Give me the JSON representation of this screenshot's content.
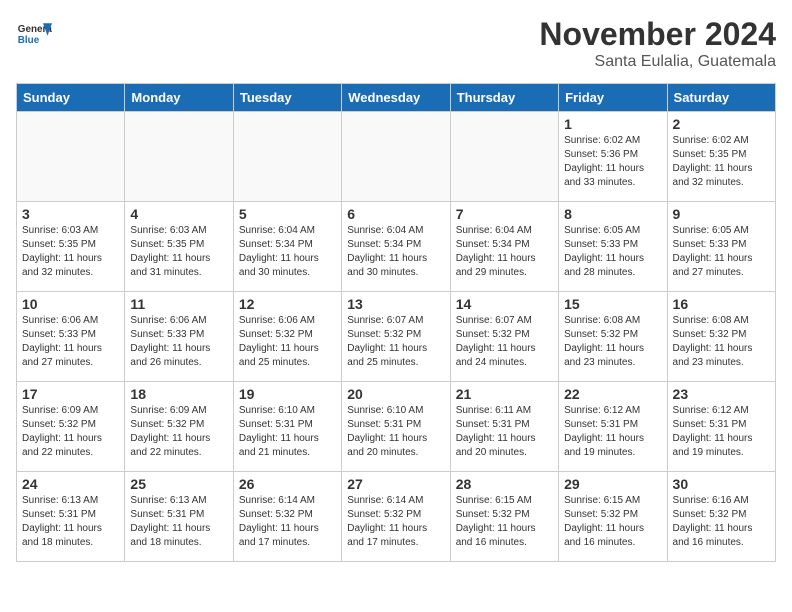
{
  "header": {
    "logo_general": "General",
    "logo_blue": "Blue",
    "month_title": "November 2024",
    "location": "Santa Eulalia, Guatemala"
  },
  "weekdays": [
    "Sunday",
    "Monday",
    "Tuesday",
    "Wednesday",
    "Thursday",
    "Friday",
    "Saturday"
  ],
  "weeks": [
    [
      {
        "day": "",
        "info": ""
      },
      {
        "day": "",
        "info": ""
      },
      {
        "day": "",
        "info": ""
      },
      {
        "day": "",
        "info": ""
      },
      {
        "day": "",
        "info": ""
      },
      {
        "day": "1",
        "info": "Sunrise: 6:02 AM\nSunset: 5:36 PM\nDaylight: 11 hours\nand 33 minutes."
      },
      {
        "day": "2",
        "info": "Sunrise: 6:02 AM\nSunset: 5:35 PM\nDaylight: 11 hours\nand 32 minutes."
      }
    ],
    [
      {
        "day": "3",
        "info": "Sunrise: 6:03 AM\nSunset: 5:35 PM\nDaylight: 11 hours\nand 32 minutes."
      },
      {
        "day": "4",
        "info": "Sunrise: 6:03 AM\nSunset: 5:35 PM\nDaylight: 11 hours\nand 31 minutes."
      },
      {
        "day": "5",
        "info": "Sunrise: 6:04 AM\nSunset: 5:34 PM\nDaylight: 11 hours\nand 30 minutes."
      },
      {
        "day": "6",
        "info": "Sunrise: 6:04 AM\nSunset: 5:34 PM\nDaylight: 11 hours\nand 30 minutes."
      },
      {
        "day": "7",
        "info": "Sunrise: 6:04 AM\nSunset: 5:34 PM\nDaylight: 11 hours\nand 29 minutes."
      },
      {
        "day": "8",
        "info": "Sunrise: 6:05 AM\nSunset: 5:33 PM\nDaylight: 11 hours\nand 28 minutes."
      },
      {
        "day": "9",
        "info": "Sunrise: 6:05 AM\nSunset: 5:33 PM\nDaylight: 11 hours\nand 27 minutes."
      }
    ],
    [
      {
        "day": "10",
        "info": "Sunrise: 6:06 AM\nSunset: 5:33 PM\nDaylight: 11 hours\nand 27 minutes."
      },
      {
        "day": "11",
        "info": "Sunrise: 6:06 AM\nSunset: 5:33 PM\nDaylight: 11 hours\nand 26 minutes."
      },
      {
        "day": "12",
        "info": "Sunrise: 6:06 AM\nSunset: 5:32 PM\nDaylight: 11 hours\nand 25 minutes."
      },
      {
        "day": "13",
        "info": "Sunrise: 6:07 AM\nSunset: 5:32 PM\nDaylight: 11 hours\nand 25 minutes."
      },
      {
        "day": "14",
        "info": "Sunrise: 6:07 AM\nSunset: 5:32 PM\nDaylight: 11 hours\nand 24 minutes."
      },
      {
        "day": "15",
        "info": "Sunrise: 6:08 AM\nSunset: 5:32 PM\nDaylight: 11 hours\nand 23 minutes."
      },
      {
        "day": "16",
        "info": "Sunrise: 6:08 AM\nSunset: 5:32 PM\nDaylight: 11 hours\nand 23 minutes."
      }
    ],
    [
      {
        "day": "17",
        "info": "Sunrise: 6:09 AM\nSunset: 5:32 PM\nDaylight: 11 hours\nand 22 minutes."
      },
      {
        "day": "18",
        "info": "Sunrise: 6:09 AM\nSunset: 5:32 PM\nDaylight: 11 hours\nand 22 minutes."
      },
      {
        "day": "19",
        "info": "Sunrise: 6:10 AM\nSunset: 5:31 PM\nDaylight: 11 hours\nand 21 minutes."
      },
      {
        "day": "20",
        "info": "Sunrise: 6:10 AM\nSunset: 5:31 PM\nDaylight: 11 hours\nand 20 minutes."
      },
      {
        "day": "21",
        "info": "Sunrise: 6:11 AM\nSunset: 5:31 PM\nDaylight: 11 hours\nand 20 minutes."
      },
      {
        "day": "22",
        "info": "Sunrise: 6:12 AM\nSunset: 5:31 PM\nDaylight: 11 hours\nand 19 minutes."
      },
      {
        "day": "23",
        "info": "Sunrise: 6:12 AM\nSunset: 5:31 PM\nDaylight: 11 hours\nand 19 minutes."
      }
    ],
    [
      {
        "day": "24",
        "info": "Sunrise: 6:13 AM\nSunset: 5:31 PM\nDaylight: 11 hours\nand 18 minutes."
      },
      {
        "day": "25",
        "info": "Sunrise: 6:13 AM\nSunset: 5:31 PM\nDaylight: 11 hours\nand 18 minutes."
      },
      {
        "day": "26",
        "info": "Sunrise: 6:14 AM\nSunset: 5:32 PM\nDaylight: 11 hours\nand 17 minutes."
      },
      {
        "day": "27",
        "info": "Sunrise: 6:14 AM\nSunset: 5:32 PM\nDaylight: 11 hours\nand 17 minutes."
      },
      {
        "day": "28",
        "info": "Sunrise: 6:15 AM\nSunset: 5:32 PM\nDaylight: 11 hours\nand 16 minutes."
      },
      {
        "day": "29",
        "info": "Sunrise: 6:15 AM\nSunset: 5:32 PM\nDaylight: 11 hours\nand 16 minutes."
      },
      {
        "day": "30",
        "info": "Sunrise: 6:16 AM\nSunset: 5:32 PM\nDaylight: 11 hours\nand 16 minutes."
      }
    ]
  ]
}
